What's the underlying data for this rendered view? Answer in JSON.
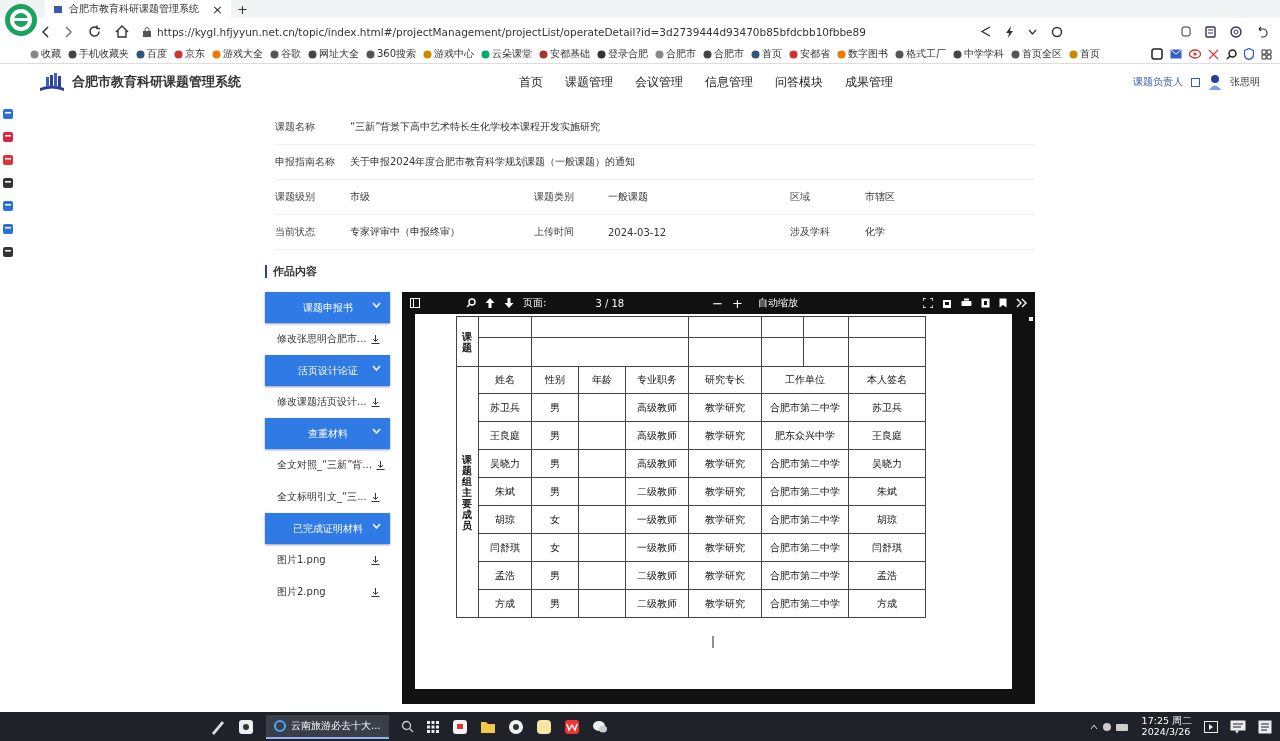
{
  "browser": {
    "tab_title": "合肥市教育科研课题管理系统",
    "tab_close": "×",
    "new_tab": "+",
    "url": "https://kygl.hfjyyun.net.cn/topic/index.html#/projectManagement/projectList/operateDetail?id=3d2739444d93470b85bfdcbb10fbbe89",
    "bookmarks": [
      "收藏",
      "手机收藏夹",
      "百度",
      "京东",
      "游戏大全",
      "谷歌",
      "网址大全",
      "360搜索",
      "游戏中心",
      "云朵课堂",
      "安都基础",
      "登录合肥",
      "合肥市",
      "合肥市",
      "首页",
      "安都省",
      "数字图书",
      "格式工厂",
      "中学学科",
      "首页全区",
      "首页"
    ]
  },
  "app": {
    "title": "合肥市教育科研课题管理系统",
    "nav": [
      "首页",
      "课题管理",
      "会议管理",
      "信息管理",
      "问答模块",
      "成果管理"
    ],
    "user_role": "课题负责人",
    "user_name": "张思明"
  },
  "details": [
    [
      {
        "label": "课题名称",
        "value": "“三新”背景下高中艺术特长生化学校本课程开发实施研究"
      }
    ],
    [
      {
        "label": "申报指南名称",
        "value": "关于申报2024年度合肥市教育科学规划课题（一般课题）的通知"
      }
    ],
    [
      {
        "label": "课题级别",
        "value": "市级"
      },
      {
        "label": "课题类别",
        "value": "一般课题"
      },
      {
        "label": "区域",
        "value": "市辖区"
      }
    ],
    [
      {
        "label": "当前状态",
        "value": "专家评审中（申报终审）"
      },
      {
        "label": "上传时间",
        "value": "2024-03-12"
      },
      {
        "label": "涉及学科",
        "value": "化学"
      }
    ]
  ],
  "section_title": "作品内容",
  "materials": [
    {
      "title": "课题申报书",
      "items": [
        "修改张思明合肥市..."
      ]
    },
    {
      "title": "活页设计论证",
      "items": [
        "修改课题活页设计..."
      ]
    },
    {
      "title": "查重材料",
      "items": [
        "全文对照_“三新”背...",
        "全文标明引文_“三..."
      ]
    },
    {
      "title": "已完成证明材料",
      "items": [
        "图片1.png",
        "图片2.png"
      ]
    }
  ],
  "pdf_viewer": {
    "page_label": "页面:",
    "page": "3 / 18",
    "zoom_out": "−",
    "zoom_in": "+",
    "zoom": "自动缩放"
  },
  "document_table": {
    "top_label": "课题",
    "group_label": "课题组主要成员",
    "columns": [
      "姓名",
      "性别",
      "年龄",
      "专业职务",
      "研究专长",
      "工作单位",
      "本人签名"
    ],
    "rows": [
      [
        "苏卫兵",
        "男",
        "",
        "高级教师",
        "教学研究",
        "合肥市第二中学",
        "苏卫兵"
      ],
      [
        "王良庭",
        "男",
        "",
        "高级教师",
        "教学研究",
        "肥东众兴中学",
        "王良庭"
      ],
      [
        "吴晓力",
        "男",
        "",
        "高级教师",
        "教学研究",
        "合肥市第二中学",
        "吴晓力"
      ],
      [
        "朱斌",
        "男",
        "",
        "二级教师",
        "教学研究",
        "合肥市第二中学",
        "朱斌"
      ],
      [
        "胡琼",
        "女",
        "",
        "一级教师",
        "教学研究",
        "合肥市第二中学",
        "胡琼"
      ],
      [
        "闫舒琪",
        "女",
        "",
        "一级教师",
        "教学研究",
        "合肥市第二中学",
        "闫舒琪"
      ],
      [
        "孟浩",
        "男",
        "",
        "二级教师",
        "教学研究",
        "合肥市第二中学",
        "孟浩"
      ],
      [
        "方成",
        "男",
        "",
        "二级教师",
        "教学研究",
        "合肥市第二中学",
        "方成"
      ]
    ]
  },
  "taskbar": {
    "window_title": "云南旅游必去十大...",
    "time": "17:25 周二",
    "date": "2024/3/26"
  }
}
